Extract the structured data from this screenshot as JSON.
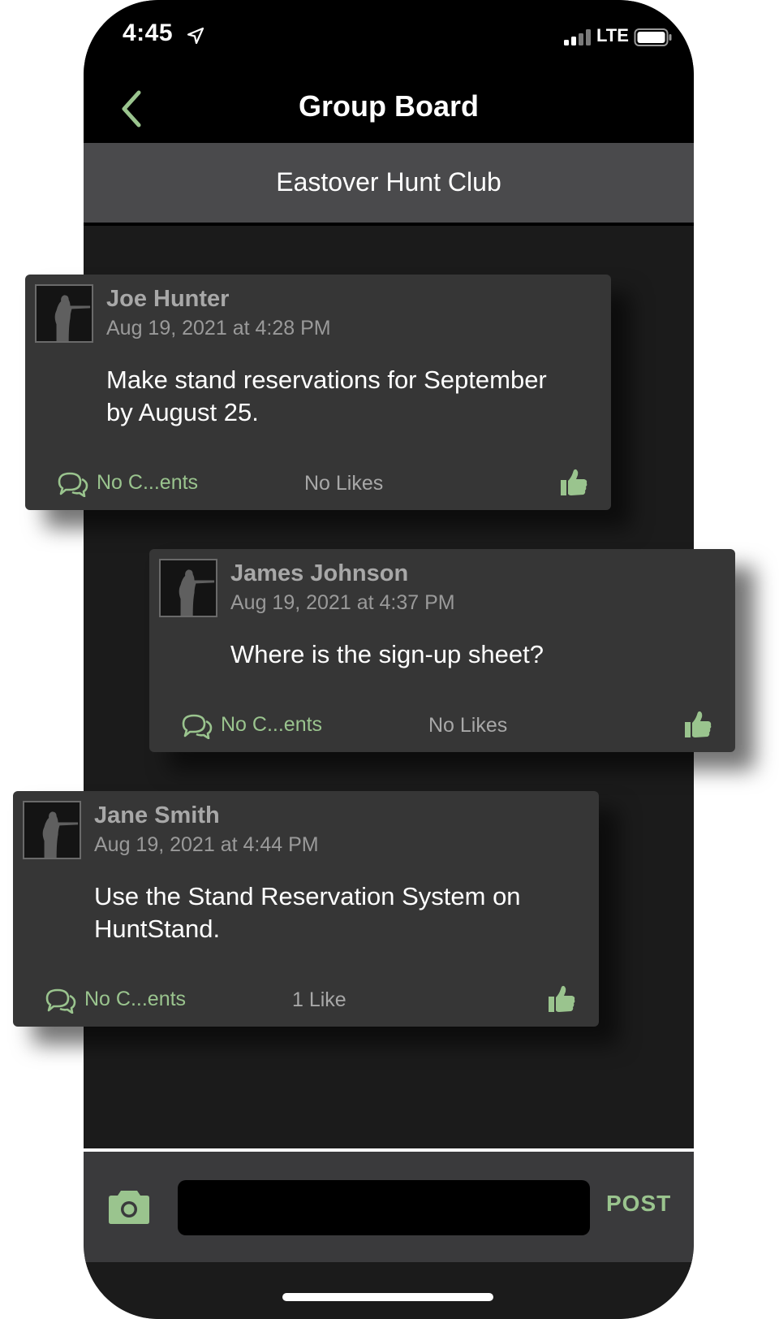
{
  "status_bar": {
    "time": "4:45",
    "network": "LTE"
  },
  "nav": {
    "title": "Group Board"
  },
  "group": {
    "name": "Eastover Hunt Club"
  },
  "posts": [
    {
      "author": "Joe Hunter",
      "timestamp": "Aug 19, 2021 at 4:28 PM",
      "body": "Make stand reservations for September by August 25.",
      "comments_label": "No C...ents",
      "likes_label": "No Likes"
    },
    {
      "author": "James Johnson",
      "timestamp": "Aug 19, 2021 at 4:37 PM",
      "body": "Where is the sign-up sheet?",
      "comments_label": "No C...ents",
      "likes_label": "No Likes"
    },
    {
      "author": "Jane Smith",
      "timestamp": "Aug 19, 2021 at 4:44 PM",
      "body": "Use the Stand Reservation System on HuntStand.",
      "comments_label": "No C...ents",
      "likes_label": "1 Like"
    }
  ],
  "composer": {
    "message_value": "",
    "post_label": "POST"
  },
  "icons": {
    "back": "chevron-left-icon",
    "location": "location-arrow-icon",
    "signal": "cellular-signal-icon",
    "battery": "battery-icon",
    "avatar": "hunter-silhouette-icon",
    "comments": "speech-bubbles-icon",
    "like": "thumbs-up-icon",
    "camera": "camera-icon"
  },
  "colors": {
    "accent_green": "#9ac48e",
    "card_bg": "#363636",
    "header_bg": "#000000",
    "subheader_bg": "#4a4a4c",
    "feed_bg": "#1b1b1b"
  }
}
